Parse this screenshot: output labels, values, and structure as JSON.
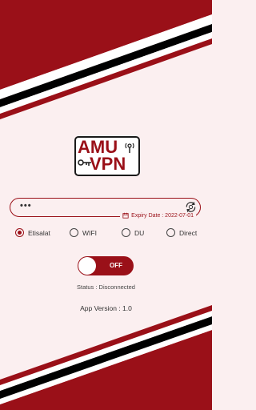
{
  "logo": {
    "line1": "AMU",
    "line2": "VPN",
    "icon": "key-icon"
  },
  "key_field": {
    "value": "•••",
    "refresh_icon": "refresh-icon"
  },
  "expiry": {
    "label": "Expiry Date : 2022-07-01",
    "icon": "calendar-icon"
  },
  "connection_types": [
    {
      "label": "Etisalat",
      "selected": true
    },
    {
      "label": "WIFI",
      "selected": false
    },
    {
      "label": "DU",
      "selected": false
    },
    {
      "label": "Direct",
      "selected": false
    }
  ],
  "toggle": {
    "label": "OFF",
    "state": "off"
  },
  "status": {
    "text": "Status : Disconnected"
  },
  "app": {
    "version": "App Version : 1.0"
  },
  "colors": {
    "accent": "#9a1018",
    "stripe_dark": "#000000",
    "background": "#fbeff0"
  }
}
